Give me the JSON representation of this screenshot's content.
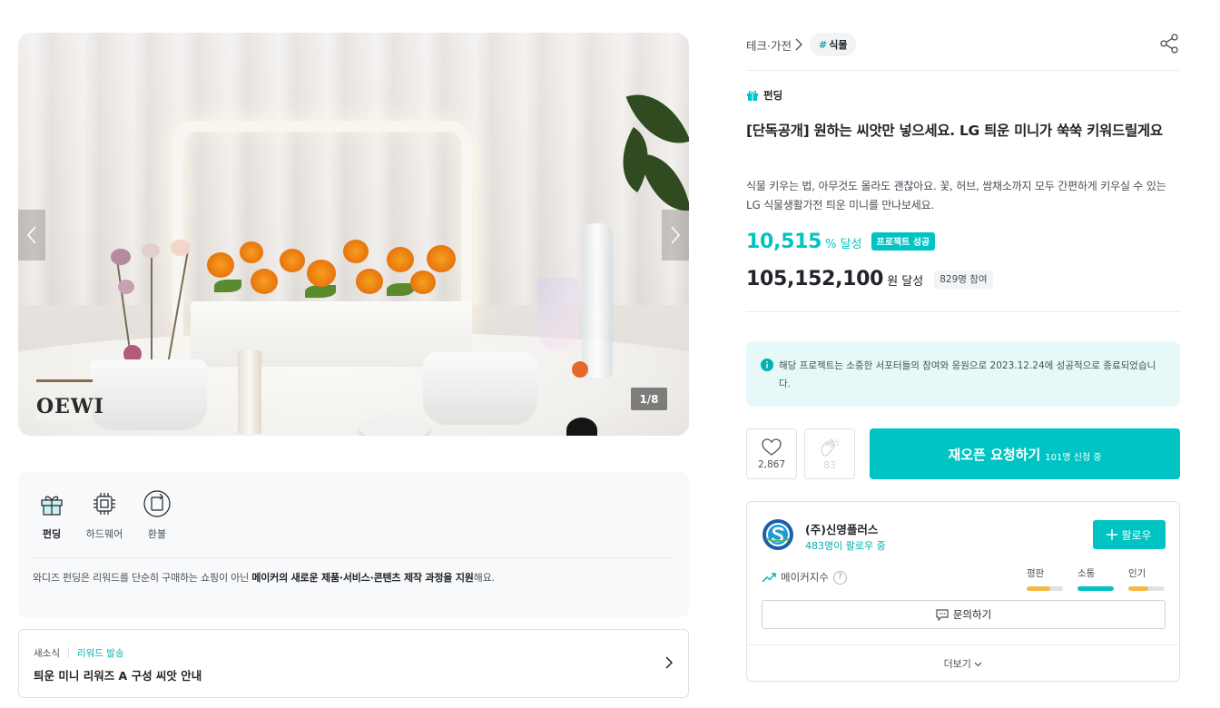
{
  "hero": {
    "counter": "1/8",
    "book_text": "OEWI"
  },
  "info_box": {
    "icons": [
      {
        "label": "펀딩",
        "icon": "gift-icon",
        "active": true
      },
      {
        "label": "하드웨어",
        "icon": "chip-icon",
        "active": false
      },
      {
        "label": "환불",
        "icon": "refund-icon",
        "active": false
      }
    ],
    "desc_prefix": "와디즈 펀딩은 리워드를 단순히 구매하는 쇼핑이 아닌 ",
    "desc_bold": "메이커의 새로운 제품·서비스·콘텐츠 제작 과정을 지원",
    "desc_suffix": "해요."
  },
  "news": {
    "tag1": "새소식",
    "tag2": "리워드 발송",
    "title": "틔운 미니 리워즈 A 구성 씨앗 안내"
  },
  "breadcrumb": {
    "category": "테크·가전",
    "tag_hash": "#",
    "tag": "식물"
  },
  "project": {
    "type_label": "펀딩",
    "title": "[단독공개] 원하는 씨앗만 넣으세요. LG 틔운 미니가 쑥쑥 키워드릴게요",
    "description": "식물 키우는 법, 아무것도 몰라도 괜찮아요. 꽃, 허브, 쌈채소까지 모두 간편하게 키우실 수 있는 LG 식물생활가전 틔운 미니를 만나보세요.",
    "rate": "10,515",
    "rate_unit": "% 달성",
    "success_badge": "프로젝트 성공",
    "amount": "105,152,100",
    "amount_unit": "원 달성",
    "supporters": "829명 참여",
    "notice": "해당 프로젝트는 소중한 서포터들의 참여와 응원으로 2023.12.24에 성공적으로 종료되었습니다."
  },
  "actions": {
    "like_count": "2,867",
    "cheer_count": "83",
    "reopen_label": "재오픈 요청하기",
    "reopen_sub": "101명 신청 중"
  },
  "maker": {
    "name": "(주)신영플러스",
    "followers": "483명이 팔로우 중",
    "follow_label": "팔로우",
    "index_label": "메이커지수",
    "metrics": [
      {
        "label": "평판",
        "level": 0.65,
        "color": "#f5b945"
      },
      {
        "label": "소통",
        "level": 1.0,
        "color": "#00c4c4"
      },
      {
        "label": "인기",
        "level": 0.55,
        "color": "#f5b945"
      }
    ],
    "inquiry_label": "문의하기",
    "more_label": "더보기"
  },
  "colors": {
    "accent": "#00c4c4",
    "accent_text": "#00b2b2"
  }
}
